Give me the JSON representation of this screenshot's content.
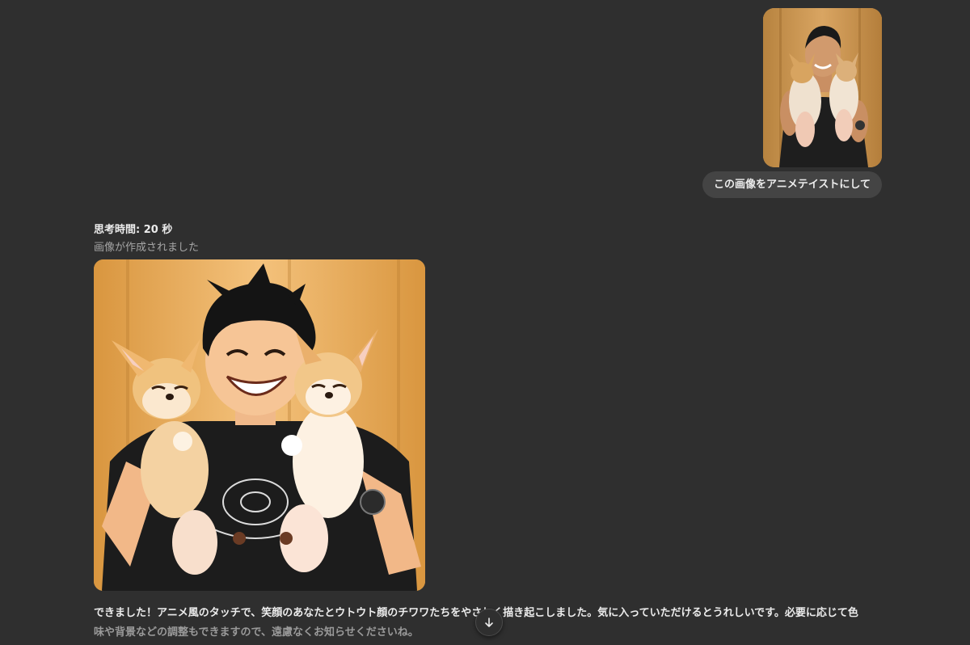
{
  "user_message": {
    "attachment_icon": "photo-thumbnail",
    "text": "この画像をアニメテイストにして"
  },
  "assistant": {
    "thinking_label": "思考時間: 20 秒",
    "status": "画像が作成されました",
    "image_icon": "generated-anime-image",
    "reply_line1": "できました！アニメ風のタッチで、笑顔のあなたとウトウト顔のチワワたちをやさしく描き起こしました。気に入っていただけるとうれしいです。必要に応じて色",
    "reply_line2": "味や背景などの調整もできますので、遠慮なくお知らせくださいね。"
  },
  "scroll_button_icon": "arrow-down-icon",
  "colors": {
    "background": "#2f2f2f",
    "bubble": "#444444",
    "muted_text": "#a6a6a6"
  }
}
